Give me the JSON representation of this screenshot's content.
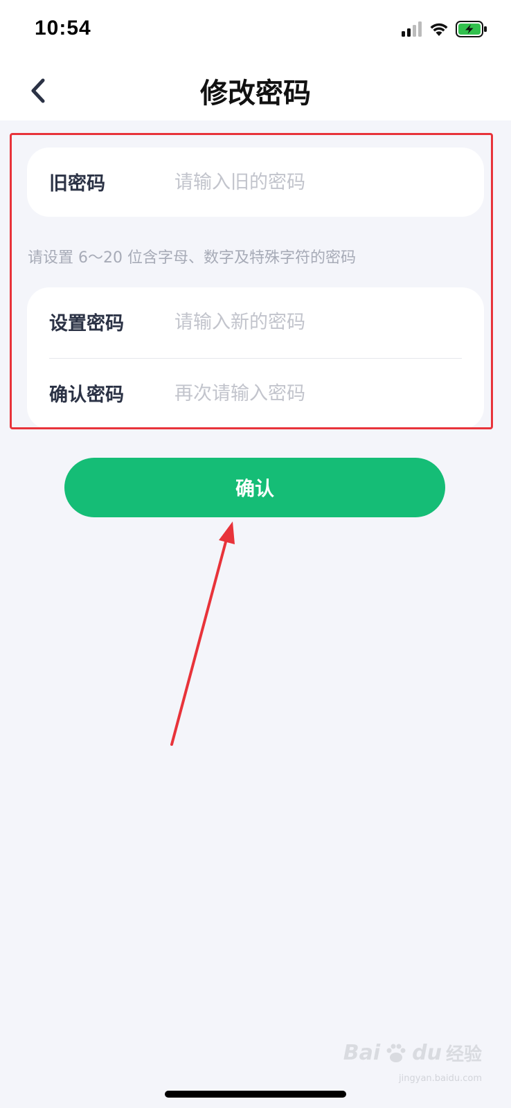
{
  "status_bar": {
    "time": "10:54",
    "icons": [
      "signal-icon",
      "wifi-icon",
      "battery-charging-icon"
    ]
  },
  "header": {
    "back_icon": "chevron-left-icon",
    "title": "修改密码"
  },
  "old_password": {
    "label": "旧密码",
    "placeholder": "请输入旧的密码",
    "value": ""
  },
  "hint": "请设置 6～20 位含字母、数字及特殊字符的密码",
  "new_password": {
    "label": "设置密码",
    "placeholder": "请输入新的密码",
    "value": ""
  },
  "confirm_password": {
    "label": "确认密码",
    "placeholder": "再次请输入密码",
    "value": ""
  },
  "confirm_button": {
    "label": "确认"
  },
  "colors": {
    "accent": "#15bd76",
    "background": "#f4f5fa",
    "annotation": "#e8333a"
  },
  "watermark": {
    "brand": "Bai",
    "brand_tail": "du",
    "cn": "经验",
    "sub": "jingyan.baidu.com"
  }
}
